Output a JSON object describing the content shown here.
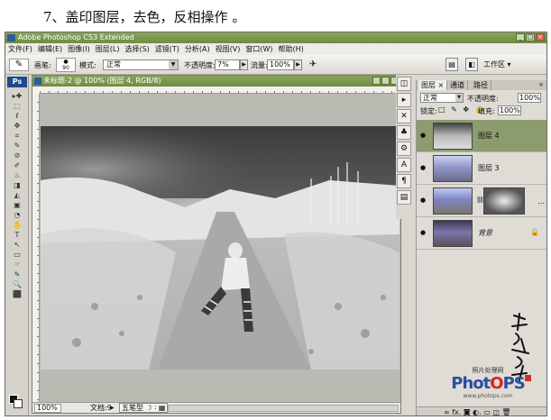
{
  "caption": "7、盖印图层，去色，反相操作 。",
  "app": {
    "title": "Adobe Photoshop CS3 Extended",
    "window_buttons": [
      "_",
      "□",
      "×"
    ]
  },
  "menu": [
    "文件(F)",
    "编辑(E)",
    "图像(I)",
    "图层(L)",
    "选择(S)",
    "滤镜(T)",
    "分析(A)",
    "视图(V)",
    "窗口(W)",
    "帮助(H)"
  ],
  "options": {
    "tool_icon": "brush-icon",
    "brush_label": "画笔:",
    "brush_size": "90",
    "mode_label": "模式:",
    "mode_value": "正常",
    "opacity_label": "不透明度:",
    "opacity_value": "7%",
    "flow_label": "流量:",
    "flow_value": "100%",
    "workspace_label": "工作区 ▾"
  },
  "document": {
    "title": "未标题-2 @ 100% (图层 4, RGB/8)",
    "zoom": "100%",
    "status": "文档:9",
    "ime": "五笔型 ☽ ∶ ▦"
  },
  "toolbox": {
    "logo": "Ps",
    "tools": [
      "▸✚",
      "⬚",
      "ℓ",
      "✥",
      "⌗",
      "✎",
      "⊘",
      "✐",
      "♨",
      "◨",
      "◭",
      "▣",
      "◔",
      "✋",
      "T",
      "↖",
      "▭",
      "☞",
      "✎",
      "🔍",
      "⬛"
    ]
  },
  "layers_panel": {
    "tabs": [
      "图层 ×",
      "通道",
      "路径"
    ],
    "close": "×",
    "blend_mode": "正常",
    "opacity_label": "不透明度:",
    "opacity_value": "100%",
    "lock_label": "锁定:",
    "lock_icons": "□ ✎ ✥ 🔒",
    "fill_label": "填充:",
    "fill_value": "100%",
    "layers": [
      {
        "name": "图层 4",
        "selected": true
      },
      {
        "name": "图层 3",
        "selected": false
      },
      {
        "name": "",
        "selected": false,
        "has_mask": true,
        "ellipsis": "..."
      },
      {
        "name": "背景",
        "selected": false,
        "locked": true
      }
    ],
    "footer_icons": "∞ fx. ◙ ◐. ▭ ◫ 🗑"
  },
  "brand": {
    "sub": "照片处理网",
    "main_a": "Phot",
    "main_o": "O",
    "main_b": "PS",
    "url": "www.photops.com"
  },
  "colors": {
    "title_green": "#7b9a4e",
    "selected_layer": "#8c9c6e",
    "ps_blue": "#1c4d8e"
  }
}
